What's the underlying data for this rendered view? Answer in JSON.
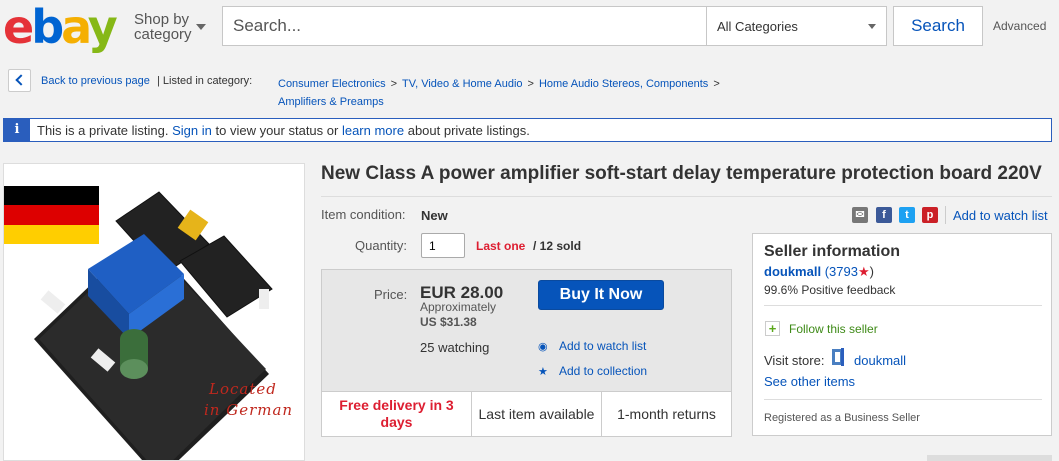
{
  "header": {
    "logo_letters": [
      "e",
      "b",
      "a",
      "y"
    ],
    "shop_by_line1": "Shop by",
    "shop_by_line2": "category",
    "search_placeholder": "Search...",
    "category_selected": "All Categories",
    "search_button": "Search",
    "advanced": "Advanced"
  },
  "breadcrumb": {
    "back": "Back to previous page",
    "listed_in": "| Listed in category:",
    "path": [
      "Consumer Electronics",
      "TV, Video & Home Audio",
      "Home Audio Stereos, Components",
      "Amplifiers & Preamps"
    ],
    "separator": ">"
  },
  "private_notice": {
    "icon": "i",
    "text_1": "This is a private listing.",
    "sign_in": "Sign in",
    "text_2": "to view your status or",
    "learn_more": "learn more",
    "text_3": "about private listings."
  },
  "image": {
    "overlay_text_1": "Located",
    "overlay_text_2": "in German",
    "flag_colors": [
      "#000000",
      "#dd0000",
      "#ffce00"
    ]
  },
  "listing": {
    "title": "New Class A power amplifier soft-start delay temperature protection board 220V",
    "condition_label": "Item condition:",
    "condition_value": "New",
    "quantity_label": "Quantity:",
    "quantity_value": "1",
    "last_one": "Last one",
    "sold": "/ 12 sold",
    "share_icons": [
      "email-icon",
      "facebook-icon",
      "twitter-icon",
      "pinterest-icon"
    ],
    "add_to_watch_list_top": "Add to watch list"
  },
  "price_box": {
    "price_label": "Price:",
    "price": "EUR 28.00",
    "approximately": "Approximately",
    "approx_usd": "US $31.38",
    "buy_now": "Buy It Now",
    "watching": "25 watching",
    "add_to_watch_list": "Add to watch list",
    "add_to_collection": "Add to collection",
    "features": {
      "delivery": "Free delivery in 3 days",
      "last_item": "Last item available",
      "returns": "1-month returns"
    }
  },
  "seller": {
    "title": "Seller information",
    "name": "doukmall",
    "feedback_score": "(3793",
    "feedback_close": ")",
    "positive_feedback": "99.6% Positive feedback",
    "follow": "Follow this seller",
    "visit_store_label": "Visit store:",
    "store_name": "doukmall",
    "see_other_items": "See other items",
    "registered": "Registered as a Business Seller"
  }
}
